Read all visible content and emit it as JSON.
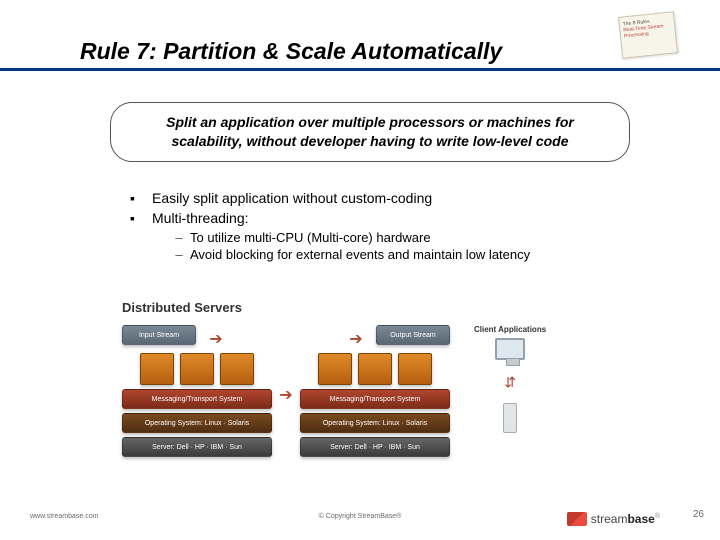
{
  "title": "Rule 7: Partition & Scale Automatically",
  "sticker": {
    "line1": "The 8 Rules",
    "line2": "Real-Time Stream Processing"
  },
  "callout": "Split an application over multiple processors or machines for scalability, without developer having to write low-level code",
  "bullets": {
    "b1": "Easily split application without custom-coding",
    "b2": "Multi-threading:",
    "s1": "To utilize multi-CPU (Multi-core) hardware",
    "s2": "Avoid blocking for external events and maintain low latency"
  },
  "diagram": {
    "title": "Distributed Servers",
    "input": "Input Stream",
    "output": "Output Stream",
    "msg": "Messaging/Transport System",
    "os": "Operating System: Linux · Solaris",
    "srv": "Server: Dell · HP · IBM · Sun",
    "client": "Client Applications"
  },
  "footer": {
    "left": "www.streambase.com",
    "center": "© Copyright StreamBase®",
    "brand_a": "stream",
    "brand_b": "base",
    "page": "26"
  }
}
